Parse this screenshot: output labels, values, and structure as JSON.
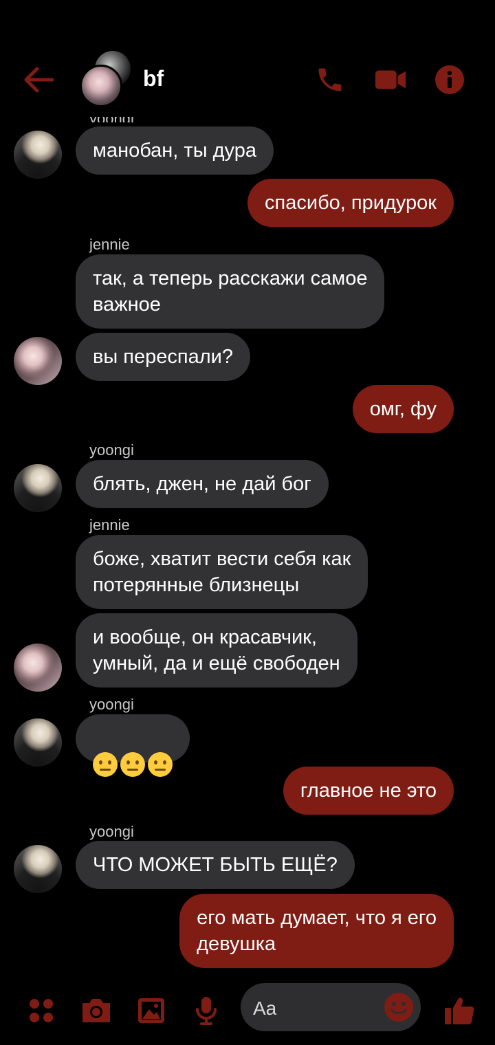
{
  "colors": {
    "background": "#000000",
    "accent": "#7f1c14",
    "incoming_bubble": "#323134",
    "outgoing_bubble": "#7f1c14",
    "text": "#ffffff",
    "sender_text": "#c9c9c9"
  },
  "header": {
    "title": "bf",
    "back_icon": "arrow-left-icon",
    "call_icon": "phone-icon",
    "video_icon": "video-camera-icon",
    "info_icon": "info-icon"
  },
  "messages": {
    "top_partial_sender": "yoongi",
    "m1": "манобан, ты дура",
    "m2": "спасибо, придурок",
    "s3": "jennie",
    "m3": "так, а теперь расскажи самое\nважное",
    "m4": "вы переспали?",
    "m5": "омг, фу",
    "s6": "yoongi",
    "m6": "блять, джен, не дай бог",
    "s7": "jennie",
    "m7": "боже, хватит вести себя как\nпотерянные близнецы",
    "m8": "и вообще, он красавчик,\nумный, да и ещё свободен",
    "s9": "yoongi",
    "m9_emoji": "neutral-face-emoji ×3",
    "m10": "главное не это",
    "s11": "yoongi",
    "m11": "ЧТО МОЖЕТ БЫТЬ ЕЩЁ?",
    "m12": "его мать думает, что я его\nдевушка"
  },
  "composer": {
    "placeholder": "Aa",
    "menu_icon": "four-dots-icon",
    "camera_icon": "camera-icon",
    "gallery_icon": "image-icon",
    "mic_icon": "microphone-icon",
    "emoji_icon": "smiley-icon",
    "like_icon": "thumbs-up-icon"
  }
}
